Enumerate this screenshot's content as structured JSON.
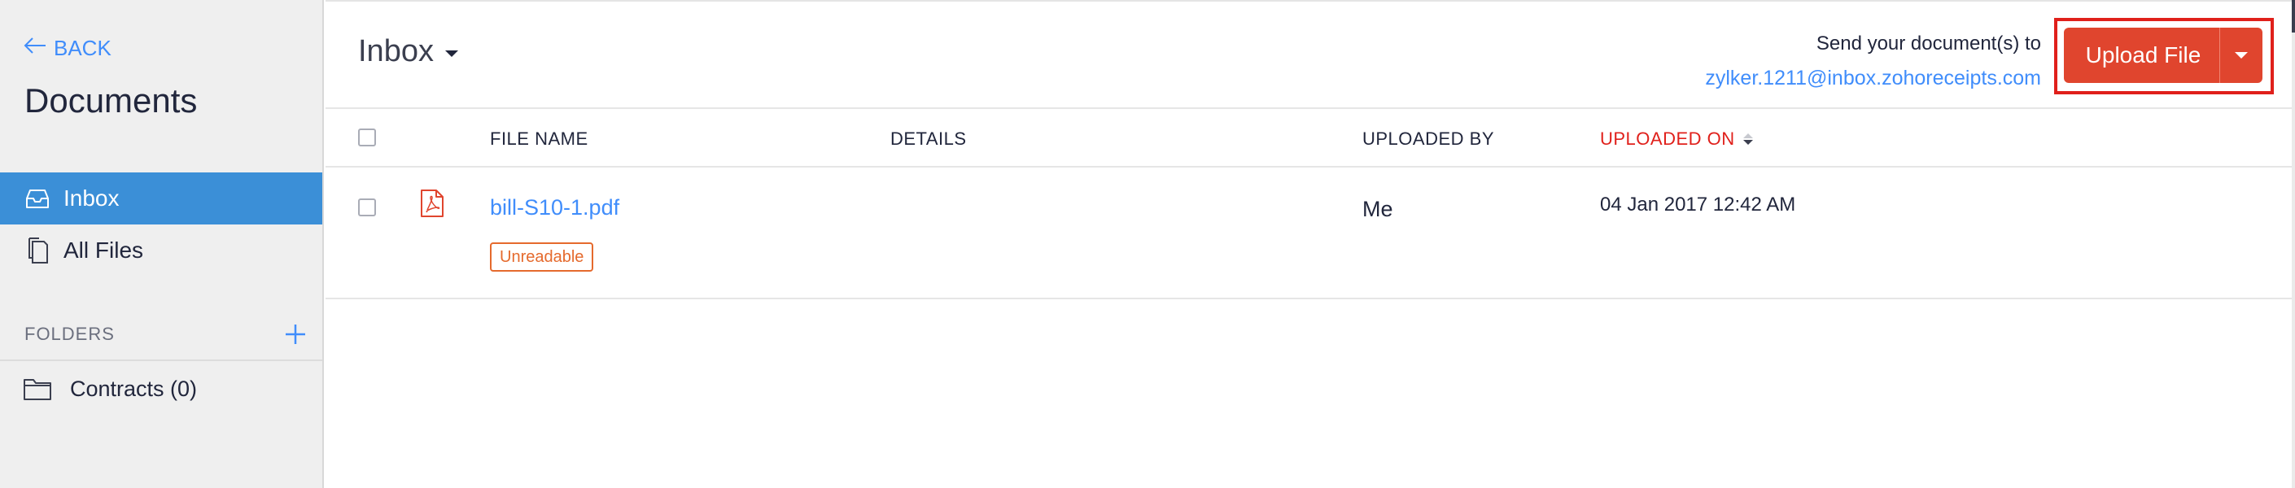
{
  "sidebar": {
    "back_label": "BACK",
    "title": "Documents",
    "items": [
      {
        "label": "Inbox",
        "icon": "inbox-icon",
        "active": true
      },
      {
        "label": "All Files",
        "icon": "files-icon",
        "active": false
      }
    ],
    "folders_label": "FOLDERS",
    "folders": [
      {
        "label": "Contracts (0)",
        "icon": "folder-icon"
      }
    ]
  },
  "header": {
    "view_label": "Inbox",
    "send_label": "Send your document(s) to",
    "send_email": "zylker.1211@inbox.zohoreceipts.com",
    "upload_label": "Upload File"
  },
  "table": {
    "columns": {
      "file_name": "FILE NAME",
      "details": "DETAILS",
      "uploaded_by": "UPLOADED BY",
      "uploaded_on": "UPLOADED ON"
    },
    "rows": [
      {
        "file_name": "bill-S10-1.pdf",
        "status": "Unreadable",
        "details": "",
        "uploaded_by": "Me",
        "uploaded_on": "04 Jan 2017 12:42 AM"
      }
    ]
  },
  "colors": {
    "accent": "#408dfb",
    "active_nav": "#3b8fd7",
    "primary_button": "#e0452e",
    "sorted_header": "#e0201b",
    "badge": "#e56a2d",
    "highlight_box": "#e0201b"
  }
}
